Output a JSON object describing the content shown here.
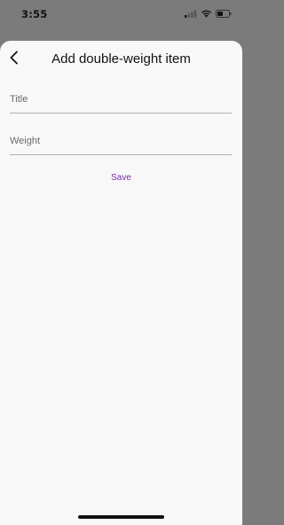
{
  "status_bar": {
    "time": "3:55",
    "icons": [
      "cellular-signal-icon",
      "wifi-icon",
      "battery-icon"
    ]
  },
  "sheet": {
    "title": "Add double-weight item",
    "back_icon": "chevron-left-icon",
    "fields": {
      "title": {
        "placeholder": "Title",
        "value": ""
      },
      "weight": {
        "placeholder": "Weight",
        "value": ""
      }
    },
    "save_label": "Save"
  },
  "colors": {
    "accent": "#7b2aa6",
    "sheet_background": "#f8f8f9",
    "backdrop": "#7b7b7b"
  }
}
